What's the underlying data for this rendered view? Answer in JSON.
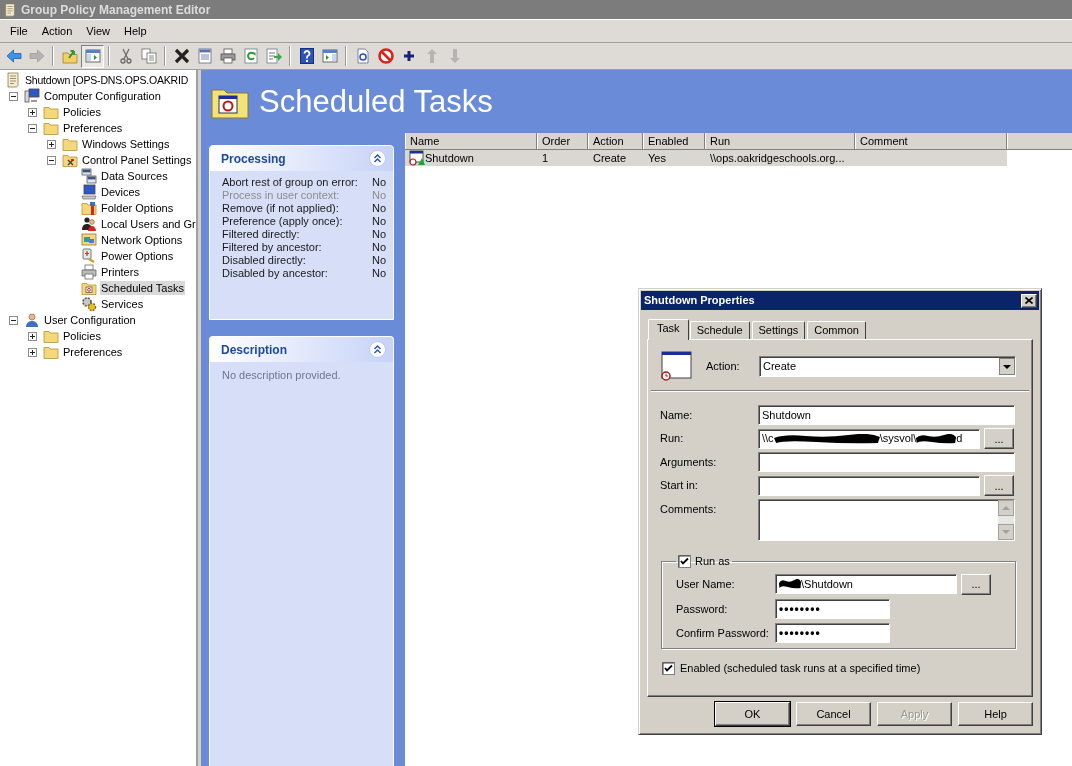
{
  "window": {
    "title": "Group Policy Management Editor"
  },
  "menu": [
    "File",
    "Action",
    "View",
    "Help"
  ],
  "toolbar": [
    [
      {
        "kind": "back",
        "disabled": false,
        "pressed": false
      },
      {
        "kind": "forward",
        "disabled": true,
        "pressed": false
      }
    ],
    [
      {
        "kind": "up",
        "disabled": false,
        "pressed": false
      },
      {
        "kind": "tree",
        "disabled": false,
        "pressed": true
      }
    ],
    [
      {
        "kind": "cut",
        "disabled": false,
        "pressed": false
      },
      {
        "kind": "copy",
        "disabled": false,
        "pressed": false
      }
    ],
    [
      {
        "kind": "delete",
        "disabled": false,
        "pressed": false
      },
      {
        "kind": "properties",
        "disabled": false,
        "pressed": false
      },
      {
        "kind": "print",
        "disabled": false,
        "pressed": false
      },
      {
        "kind": "refresh",
        "disabled": false,
        "pressed": false
      },
      {
        "kind": "export",
        "disabled": false,
        "pressed": false
      }
    ],
    [
      {
        "kind": "help",
        "disabled": false,
        "pressed": false
      },
      {
        "kind": "actionpane",
        "disabled": false,
        "pressed": false
      }
    ],
    [
      {
        "kind": "new",
        "disabled": false,
        "pressed": false
      },
      {
        "kind": "stop",
        "disabled": false,
        "pressed": false
      },
      {
        "kind": "add",
        "disabled": false,
        "pressed": false
      },
      {
        "kind": "moveup",
        "disabled": true,
        "pressed": false
      },
      {
        "kind": "movedown",
        "disabled": true,
        "pressed": false
      }
    ]
  ],
  "tree": {
    "items": [
      {
        "label": "Shutdown [OPS-DNS.OPS.OAKRID",
        "kind": "gpo",
        "selected": false,
        "children": [
          {
            "label": "Computer Configuration",
            "kind": "computer",
            "selected": false,
            "expanded": true,
            "children": [
              {
                "label": "Policies",
                "kind": "folder",
                "selected": false,
                "expanded": false
              },
              {
                "label": "Preferences",
                "kind": "folder",
                "selected": false,
                "expanded": true,
                "children": [
                  {
                    "label": "Windows Settings",
                    "kind": "folder",
                    "selected": false,
                    "expanded": false
                  },
                  {
                    "label": "Control Panel Settings",
                    "kind": "panel",
                    "selected": false,
                    "expanded": true,
                    "children": [
                      {
                        "label": "Data Sources",
                        "kind": "datasources",
                        "selected": false
                      },
                      {
                        "label": "Devices",
                        "kind": "devices",
                        "selected": false
                      },
                      {
                        "label": "Folder Options",
                        "kind": "folderoptions",
                        "selected": false
                      },
                      {
                        "label": "Local Users and Gr",
                        "kind": "localusers",
                        "selected": false
                      },
                      {
                        "label": "Network Options",
                        "kind": "network",
                        "selected": false
                      },
                      {
                        "label": "Power Options",
                        "kind": "power",
                        "selected": false
                      },
                      {
                        "label": "Printers",
                        "kind": "printers",
                        "selected": false
                      },
                      {
                        "label": "Scheduled Tasks",
                        "kind": "tasks",
                        "selected": true
                      },
                      {
                        "label": "Services",
                        "kind": "services",
                        "selected": false
                      }
                    ]
                  }
                ]
              }
            ]
          },
          {
            "label": "User Configuration",
            "kind": "user",
            "selected": false,
            "expanded": true,
            "children": [
              {
                "label": "Policies",
                "kind": "folder",
                "selected": false,
                "expanded": false
              },
              {
                "label": "Preferences",
                "kind": "folder",
                "selected": false,
                "expanded": false
              }
            ]
          }
        ]
      }
    ]
  },
  "banner": {
    "title": "Scheduled Tasks"
  },
  "processing": {
    "title": "Processing",
    "rows": [
      {
        "label": "Abort rest of group on error:",
        "value": "No",
        "disabled": false
      },
      {
        "label": "Process in user context:",
        "value": "No",
        "disabled": true
      },
      {
        "label": "Remove (if not applied):",
        "value": "No",
        "disabled": false
      },
      {
        "label": "Preference (apply once):",
        "value": "No",
        "disabled": false
      },
      {
        "label": "Filtered directly:",
        "value": "No",
        "disabled": false
      },
      {
        "label": "Filtered by ancestor:",
        "value": "No",
        "disabled": false
      },
      {
        "label": "Disabled directly:",
        "value": "No",
        "disabled": false
      },
      {
        "label": "Disabled by ancestor:",
        "value": "No",
        "disabled": false
      }
    ]
  },
  "description": {
    "title": "Description",
    "text": "No description provided."
  },
  "table": {
    "columns": [
      "Name",
      "Order",
      "Action",
      "Enabled",
      "Run",
      "Comment"
    ],
    "rows": [
      {
        "selected": true,
        "cells": [
          "Shutdown",
          "1",
          "Create",
          "Yes",
          "\\\\ops.oakridgeschools.org..."
        ]
      }
    ]
  },
  "dialog": {
    "title": "Shutdown Properties",
    "tabs": [
      {
        "label": "Task",
        "selected": true
      },
      {
        "label": "Schedule",
        "selected": false
      },
      {
        "label": "Settings",
        "selected": false
      },
      {
        "label": "Common",
        "selected": false
      }
    ],
    "action": {
      "label": "Action:",
      "value": "Create"
    },
    "fields": [
      {
        "label": "Name:",
        "kind": "text",
        "parts": [
          {
            "kind": "text",
            "text": "Shutdown"
          }
        ]
      },
      {
        "label": "Run:",
        "kind": "browse",
        "button": "...",
        "parts": [
          {
            "kind": "text",
            "text": "\\\\c"
          },
          {
            "kind": "redacted"
          },
          {
            "kind": "text",
            "text": "\\sysvol\\"
          },
          {
            "kind": "redacted"
          },
          {
            "kind": "text",
            "text": "d"
          }
        ]
      },
      {
        "label": "Arguments:",
        "kind": "text"
      },
      {
        "label": "Start in:",
        "kind": "browse",
        "button": "..."
      },
      {
        "label": "Comments:",
        "kind": "memo"
      }
    ],
    "run_as": {
      "label": "Run as",
      "checked": true,
      "fields": [
        {
          "label": "User Name:",
          "kind": "browse",
          "button": "...",
          "parts": [
            {
              "kind": "redacted"
            },
            {
              "kind": "text",
              "text": "\\Shutdown"
            }
          ]
        },
        {
          "label": "Password:",
          "kind": "password",
          "parts": [
            {
              "kind": "text",
              "text": "••••••••"
            }
          ]
        },
        {
          "label": "Confirm Password:",
          "kind": "password",
          "parts": [
            {
              "kind": "text",
              "text": "••••••••"
            }
          ]
        }
      ]
    },
    "enabled": {
      "label": "Enabled (scheduled task runs at a specified time)",
      "checked": true
    },
    "buttons": [
      {
        "label": "OK",
        "kind": "default",
        "disabled": false
      },
      {
        "label": "Cancel",
        "kind": "normal",
        "disabled": false
      },
      {
        "label": "Apply",
        "kind": "normal",
        "disabled": true
      },
      {
        "label": "Help",
        "kind": "normal",
        "disabled": false
      }
    ]
  }
}
